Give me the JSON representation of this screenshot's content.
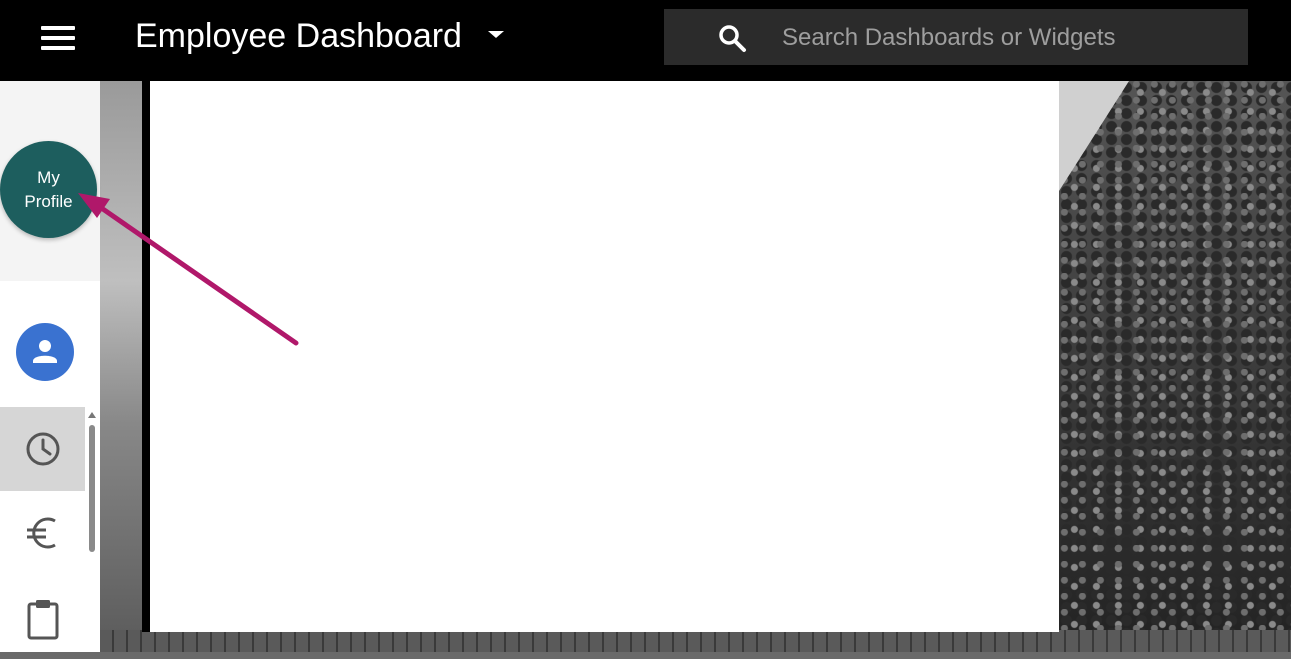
{
  "header": {
    "menu_icon": "hamburger-menu-icon",
    "title": "Employee Dashboard",
    "title_dropdown_icon": "caret-down-icon",
    "search": {
      "icon": "search-icon",
      "placeholder": "Search Dashboards or Widgets",
      "value": ""
    }
  },
  "sidebar": {
    "profile_button": {
      "line1": "My",
      "line2": "Profile"
    },
    "user_icon": "person-icon",
    "items": [
      {
        "icon": "clock-icon",
        "active": true
      },
      {
        "icon": "euro-icon",
        "active": false
      },
      {
        "icon": "clipboard-icon",
        "active": false
      }
    ]
  },
  "annotation": {
    "type": "arrow",
    "color": "#b0186a",
    "points_to": "My Profile"
  },
  "colors": {
    "topbar_bg": "#000000",
    "search_bg": "#2b2b2b",
    "profile_button_bg": "#1d5e5e",
    "avatar_bg": "#3a72d0",
    "active_item_bg": "#d6d6d6"
  }
}
